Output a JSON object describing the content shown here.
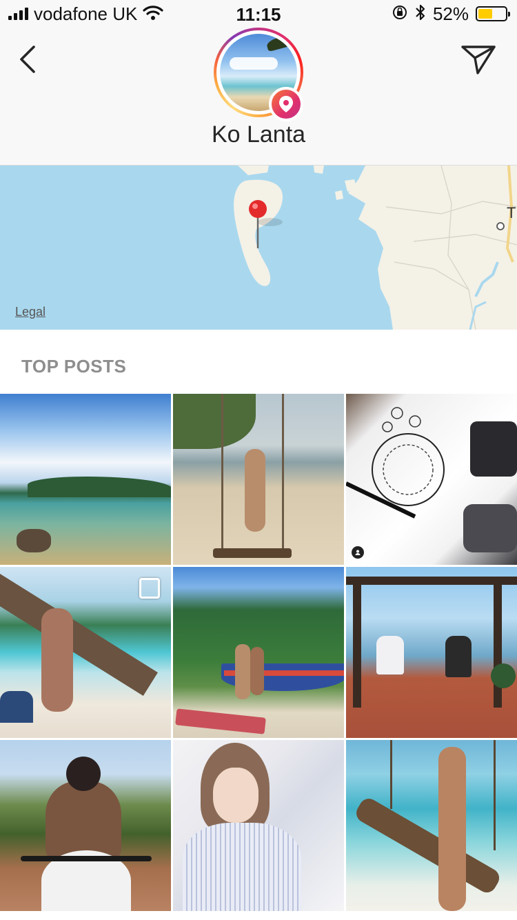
{
  "status_bar": {
    "carrier": "vodafone UK",
    "time": "11:15",
    "battery_percent": "52%",
    "battery_level": 0.52,
    "battery_color": "#ffcc00",
    "icons": [
      "signal-icon",
      "wifi-icon",
      "orientation-lock-icon",
      "bluetooth-icon",
      "battery-icon"
    ]
  },
  "header": {
    "title": "Ko Lanta",
    "back_icon": "chevron-left-icon",
    "direct_icon": "paper-plane-icon",
    "badge_icon": "location-pin-icon",
    "ring_colors": [
      "#c13584",
      "#e1306c",
      "#f77737",
      "#fcaf45"
    ]
  },
  "map": {
    "legal_label": "Legal",
    "partial_label": "T",
    "water_color": "#a9d8ee",
    "land_color": "#f4f1e7",
    "pin_color": "#e32b2b"
  },
  "top_posts": {
    "section_title": "TOP POSTS",
    "posts": [
      {
        "subject": "beach-with-clouds"
      },
      {
        "subject": "woman-on-beach-swing"
      },
      {
        "subject": "mandala-moon-drawing"
      },
      {
        "subject": "woman-on-palm-trunk"
      },
      {
        "subject": "couple-by-boat"
      },
      {
        "subject": "two-people-on-swings"
      },
      {
        "subject": "tattooed-man-on-scooter"
      },
      {
        "subject": "woman-in-striped-shirt"
      },
      {
        "subject": "woman-on-wooden-swing"
      }
    ]
  }
}
